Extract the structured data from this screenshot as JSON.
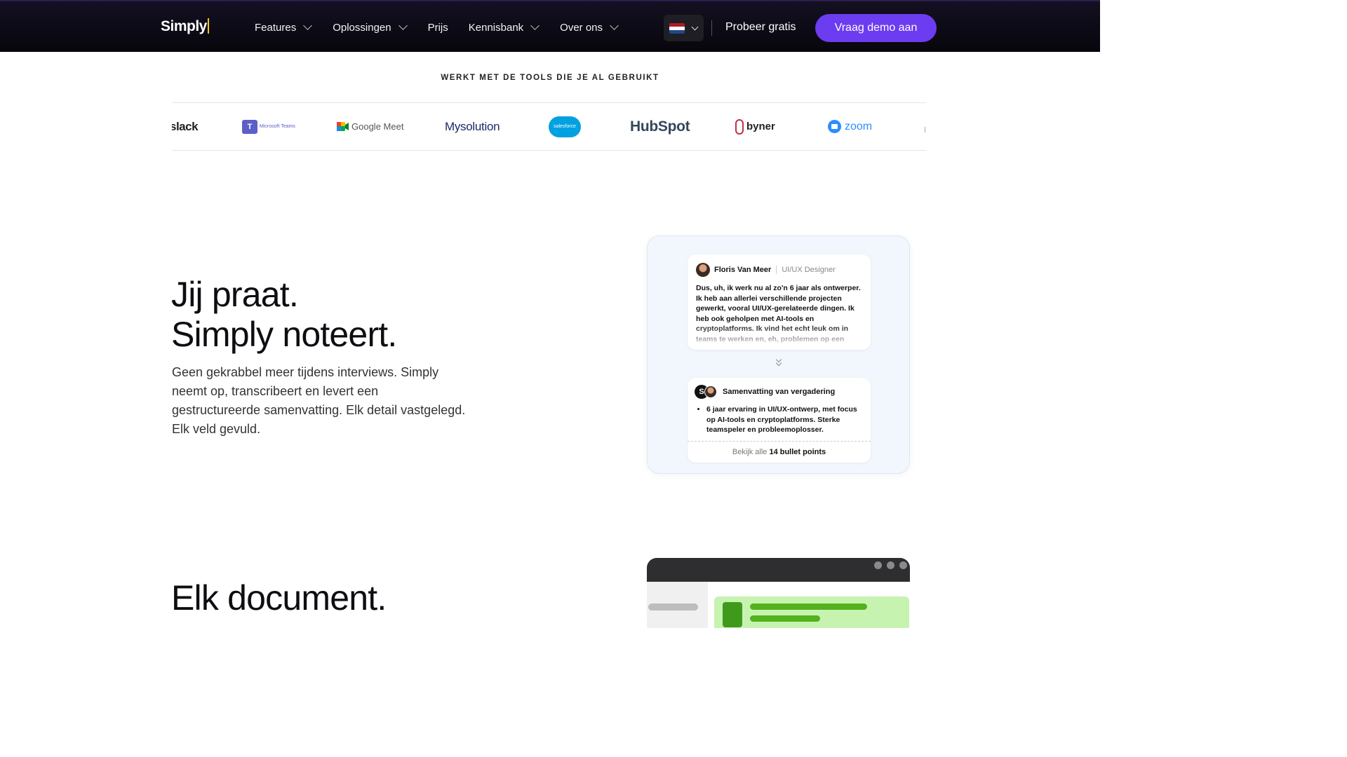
{
  "nav": {
    "logo": "Simply",
    "menu": [
      {
        "label": "Features",
        "dropdown": true
      },
      {
        "label": "Oplossingen",
        "dropdown": true
      },
      {
        "label": "Prijs",
        "dropdown": false
      },
      {
        "label": "Kennisbank",
        "dropdown": true
      },
      {
        "label": "Over ons",
        "dropdown": true
      }
    ],
    "language": "nl-flag-icon",
    "try_free": "Probeer gratis",
    "demo": "Vraag demo aan"
  },
  "tools": {
    "heading": "WERKT MET DE TOOLS DIE JE AL GEBRUIKT",
    "logos": [
      "slack",
      "Microsoft Teams",
      "Google Meet",
      "Mysolution",
      "salesforce",
      "HubSpot",
      "byner",
      "zoom"
    ]
  },
  "hero": {
    "title_line1": "Jij praat.",
    "title_line2": "Simply noteert.",
    "description": "Geen gekrabbel meer tijdens interviews. Simply neemt op, transcribeert en levert een gestructureerde samenvatting. Elk detail vastgelegd. Elk veld gevuld."
  },
  "card": {
    "speaker": "Floris Van Meer",
    "role": "UI/UX Designer",
    "transcript": "Dus, uh, ik werk nu al zo'n 6 jaar als ontwerper. Ik heb aan allerlei verschillende projecten gewerkt, vooral UI/UX-gerelateerde dingen. Ik heb ook geholpen met AI-tools en cryptoplatforms. Ik vind het echt leuk om in teams te werken en, eh, problemen op een",
    "summary_title": "Samenvatting van vergadering",
    "summary_avatar": "S",
    "bullet": "6 jaar ervaring in UI/UX-ontwerp, met focus op AI-tools en cryptoplatforms. Sterke teamspeler en probleemoplosser.",
    "footer_prefix": "Bekijk alle",
    "footer_bold": "14 bullet points"
  },
  "hero2": {
    "title": "Elk document."
  }
}
